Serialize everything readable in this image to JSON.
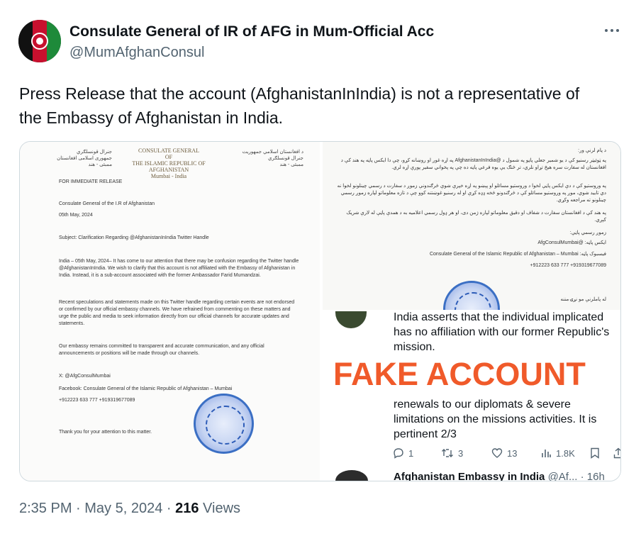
{
  "author": {
    "display_name": "Consulate General of IR of AFG in Mum-Official Acc",
    "handle": "@MumAfghanConsul"
  },
  "tweet_text": "Press Release that the account (AfghanistanInIndia) is not a representative of the Embassy of Afghanistan in India.",
  "document_left": {
    "letterhead_left": "جنرال قونسلګري\nجمهوری اسلامی افغانستان\nممبئی - هند",
    "letterhead_center": "CONSULATE GENERAL\nOF\nTHE ISLAMIC REPUBLIC OF AFGHANISTAN\nMumbai - India",
    "letterhead_right": "د افغانستان اسلامي جمهوریت\nجنرال قونسلګري\nممبئی - هند",
    "release_tag": "FOR IMMEDIATE RELEASE",
    "from": "Consulate General of the I.R of Afghanistan",
    "date": "05th May, 2024",
    "subject": "Subject: Clarification Regarding @AfghanistanInIndia Twitter Handle",
    "para1": "India – 05th May, 2024– It has come to our attention that there may be confusion regarding the Twitter handle @AfghanistanInIndia. We wish to clarify that this account is not affiliated with the Embassy of Afghanistan in India. Instead, it is a sub-account associated with the former Ambassador Farid Mumandzai.",
    "para2": "Recent speculations and statements made on this Twitter handle regarding certain events are not endorsed or confirmed by our official embassy channels. We have refrained from commenting on these matters and urge the public and media to seek information directly from our official channels for accurate updates and statements.",
    "para3": "Our embassy remains committed to transparent and accurate communication, and any official announcements or positions will be made through our channels.",
    "x_handle": "X: @AfgConsulMumbai",
    "facebook": "Facebook: Consulate General of the Islamic Republic of Afghanistan – Mumbai",
    "phones": "+912223 633 777 +919319677089",
    "thanks": "Thank you for your attention to this matter."
  },
  "document_right": {
    "salutation": "د پام لرنې ور:",
    "para1": "په ټوئیټر رسنیو کې د یو شمیر جعلي پاڼو په شمول د @AfghanistanInIndia په اړه غوږ او روښانه کړو، چې دا ایکس پاڼه په هند کې د افغانستان له سفارت سره هیڅ تړاو نلري، تر څنګ یې یوه فرعي پاڼه ده چې په پخواني سفیر پورې اړه لري.",
    "para2": "په وروستیو کې د دې ایکس پاڼې لخوا د وروستیو مسائلو او پېښو په اړه خپرې شوې څرګندونې زموږ د سفارت د رسمي چینلونو لخوا نه دي تایید شوي، موږ په وروستیو مسائلو کې د څرګندونو څخه ډډه کړې او له رسنیو غوښتنه کوو چې د تازه معلوماتو لپاره زموږ رسمي چینلونو ته مراجعه وکړي.",
    "para3": "په هند کې د افغانستان سفارت د شفاف او دقیق معلوماتو لپاره ژمن دی، او هر ډول رسمي اعلامیه به د همدې پاڼې له لارې شریک کېږي.",
    "official_pages": "زموږ رسمي پاڼې:",
    "x_line": "ایکس پاڼه: @AfgConsulMumbai",
    "facebook_line": "Consulate General of the Islamic Republic of Afghanistan – Mumbai :فیسبوک پاڼه",
    "phones": "+912223 633 777 +919319677089",
    "closing": "له پاملرنې مو نړۍ مننه"
  },
  "embedded_tweet": {
    "text1": "India asserts that the individual implicated",
    "text2": "has no affiliation with our former Republic's",
    "text3": "mission.",
    "stamp": "FAKE ACCOUNT",
    "text4": "renewals to our diplomats & severe",
    "text5": "limitations on the missions activities. It is",
    "text6": "pertinent 2/3",
    "replies": "1",
    "retweets": "3",
    "likes": "13",
    "views": "1.8K",
    "next_author": "Afghanistan Embassy in India",
    "next_meta": "@Af... · 16h"
  },
  "meta": {
    "time": "2:35 PM",
    "separator1": " · ",
    "date": "May 5, 2024",
    "separator2": " · ",
    "views_count": "216",
    "views_label": " Views"
  },
  "colors": {
    "text_primary": "#0f1419",
    "text_secondary": "#536471",
    "fake_stamp": "#f05a2a",
    "seal_blue": "#3b6fc4"
  }
}
